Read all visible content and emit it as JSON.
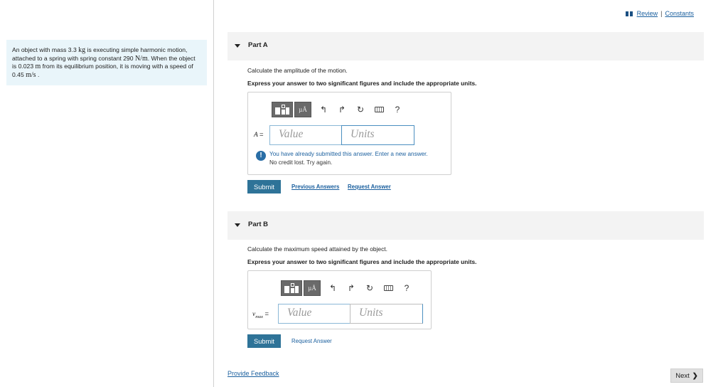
{
  "problem": {
    "intro": "An object with mass 3.3",
    "mass_unit": "kg",
    "mid1": "is executing simple harmonic motion, attached to a spring with spring constant 290",
    "spring_unit": "N/m",
    "mid2": ". When the object is 0.023",
    "dist_unit": "m",
    "mid3": "from its equilibrium position, it is moving with a speed of 0.45",
    "speed_unit": "m/s",
    "end": "."
  },
  "header": {
    "review_label": "Review",
    "separator": "|",
    "constants_label": "Constants"
  },
  "toolbar_icons": [
    "template-icon",
    "units-mu-a-icon",
    "undo-icon",
    "redo-icon",
    "reset-icon",
    "keyboard-icon",
    "help-icon"
  ],
  "toolbar": {
    "units_symbol": "µÅ",
    "undo": "↰",
    "redo": "↱",
    "reset": "↻",
    "help": "?"
  },
  "partA": {
    "title": "Part A",
    "question": "Calculate the amplitude of the motion.",
    "instruction": "Express your answer to two significant figures and include the appropriate units.",
    "variable": "A",
    "equals": "=",
    "value_placeholder": "Value",
    "units_placeholder": "Units",
    "warning": "You have already submitted this answer. Enter a new answer.",
    "warning_sub": "No credit lost. Try again.",
    "submit": "Submit",
    "previous_answers": "Previous Answers",
    "request_answer": "Request Answer"
  },
  "partB": {
    "title": "Part B",
    "question": "Calculate the maximum speed attained by the object.",
    "instruction": "Express your answer to two significant figures and include the appropriate units.",
    "variable": "v",
    "subscript": "max",
    "equals": "=",
    "value_placeholder": "Value",
    "units_placeholder": "Units",
    "submit": "Submit",
    "request_answer": "Request Answer"
  },
  "footer": {
    "feedback": "Provide Feedback",
    "next": "Next",
    "next_chevron": "❯"
  },
  "colors": {
    "accent": "#2e7398",
    "link": "#1a5f9e",
    "problem_bg": "#e9f5fa",
    "header_bg": "#f3f3f3"
  }
}
